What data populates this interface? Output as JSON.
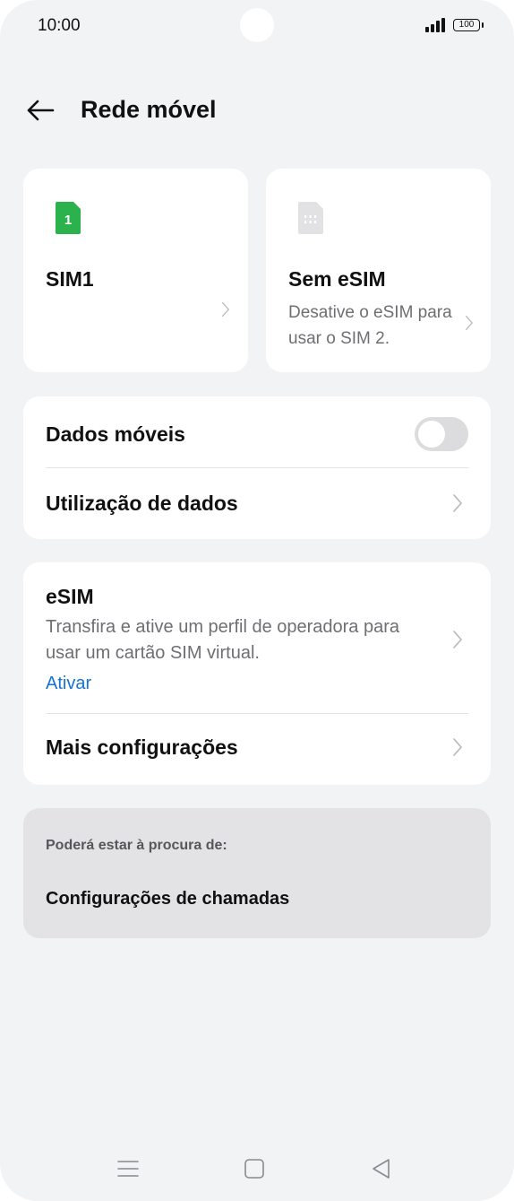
{
  "status_bar": {
    "time": "10:00",
    "battery": "100",
    "icons": [
      "signal-icon",
      "battery-icon"
    ]
  },
  "header": {
    "title": "Rede móvel",
    "back_icon": "arrow-left-icon"
  },
  "sim_cards": {
    "sim1": {
      "label": "1",
      "title": "SIM1",
      "color": "#2bb24c",
      "icon": "sim-card-icon"
    },
    "esim": {
      "title": "Sem eSIM",
      "description": "Desative o eSIM para usar o SIM 2.",
      "color": "#e2e2e4",
      "icon": "esim-chip-icon"
    }
  },
  "data_card": {
    "mobile_data_label": "Dados móveis",
    "mobile_data_enabled": false,
    "data_usage_label": "Utilização de dados"
  },
  "esim_card": {
    "title": "eSIM",
    "description": "Transfira e ative um perfil de operadora para usar um cartão SIM virtual.",
    "action": "Ativar",
    "action_color": "#1673d6",
    "more_settings_label": "Mais configurações"
  },
  "suggestions": {
    "heading": "Poderá estar à procura de:",
    "link": "Configurações de chamadas"
  },
  "nav_bar": {
    "icons": [
      "menu-icon",
      "home-icon",
      "back-triangle-icon"
    ]
  }
}
